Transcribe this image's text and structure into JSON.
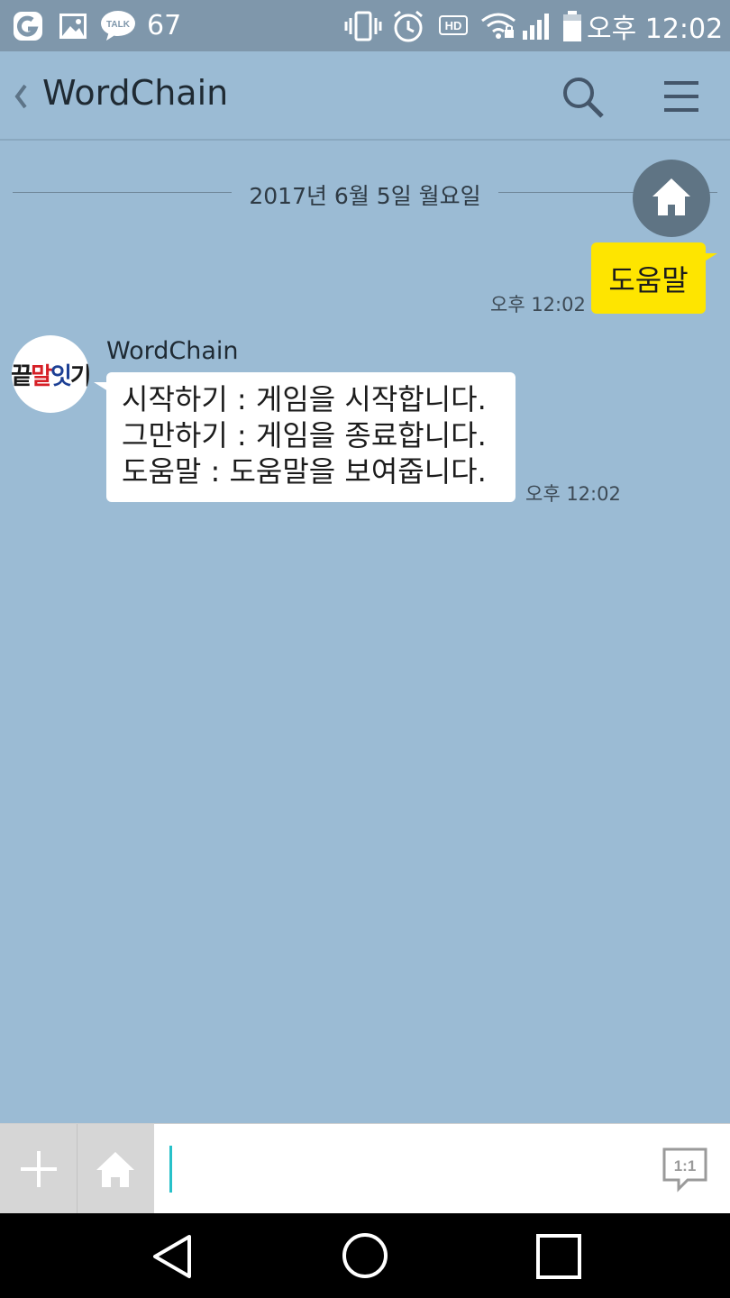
{
  "status_bar": {
    "notification_count": "67",
    "talk_badge": "TALK",
    "hd_badge": "HD",
    "time": "오후 12:02",
    "icons": [
      "app-icon",
      "gallery-icon",
      "talk-icon",
      "vibrate-icon",
      "alarm-icon",
      "hd-icon",
      "wifi-icon",
      "signal-icon",
      "battery-icon"
    ]
  },
  "header": {
    "title": "WordChain",
    "icons": [
      "back-icon",
      "search-icon",
      "menu-icon"
    ]
  },
  "chat": {
    "date": "2017년 6월 5일 월요일",
    "outgoing": {
      "text": "도움말",
      "time": "오후 12:02",
      "bubble_color": "#fee500"
    },
    "incoming": {
      "sender": "WordChain",
      "avatar_text": [
        "끝",
        "말",
        "잇",
        "기"
      ],
      "avatar_colors": [
        "#1a1a1a",
        "#d61f26",
        "#1c3f94",
        "#1a1a1a"
      ],
      "lines": [
        "시작하기 : 게임을 시작합니다.",
        "그만하기 : 게임을 종료합니다.",
        "도움말 : 도움말을 보여줍니다."
      ],
      "time": "오후 12:02"
    }
  },
  "input_bar": {
    "value": "",
    "oneone_label": "1:1",
    "cursor_color": "#27c1c9"
  },
  "nav_bar": {
    "icons": [
      "nav-back-icon",
      "nav-home-icon",
      "nav-recent-icon"
    ]
  },
  "colors": {
    "background": "#9bbbd4",
    "status_bar": "#7f97ab",
    "fab": "#5f7484"
  }
}
